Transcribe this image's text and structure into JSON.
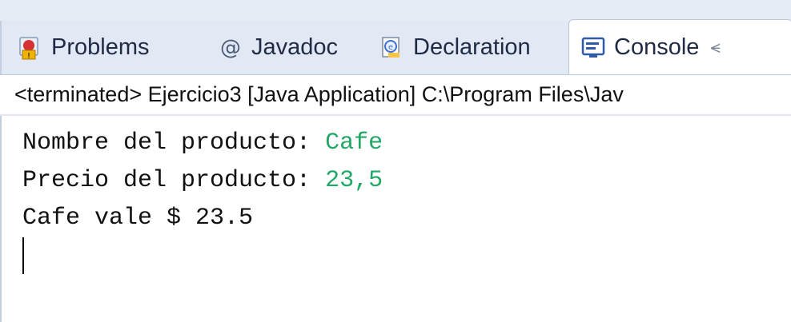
{
  "tabs": [
    {
      "label": "Problems",
      "icon": "problems-icon",
      "active": false
    },
    {
      "label": "Javadoc",
      "icon": "at-icon",
      "active": false
    },
    {
      "label": "Declaration",
      "icon": "declaration-icon",
      "active": false
    },
    {
      "label": "Console",
      "icon": "console-icon",
      "active": true
    }
  ],
  "console_tab_close": "⪪",
  "status_line": "<terminated> Ejercicio3 [Java Application] C:\\Program Files\\Jav",
  "console": {
    "lines": [
      {
        "prompt": "Nombre del producto: ",
        "input": "Cafe"
      },
      {
        "prompt": "Precio del producto: ",
        "input": "23,5"
      },
      {
        "text": "Cafe vale $ 23.5"
      }
    ]
  },
  "colors": {
    "input_text": "#21a867",
    "tab_bar_bg": "#e2e9f4"
  }
}
